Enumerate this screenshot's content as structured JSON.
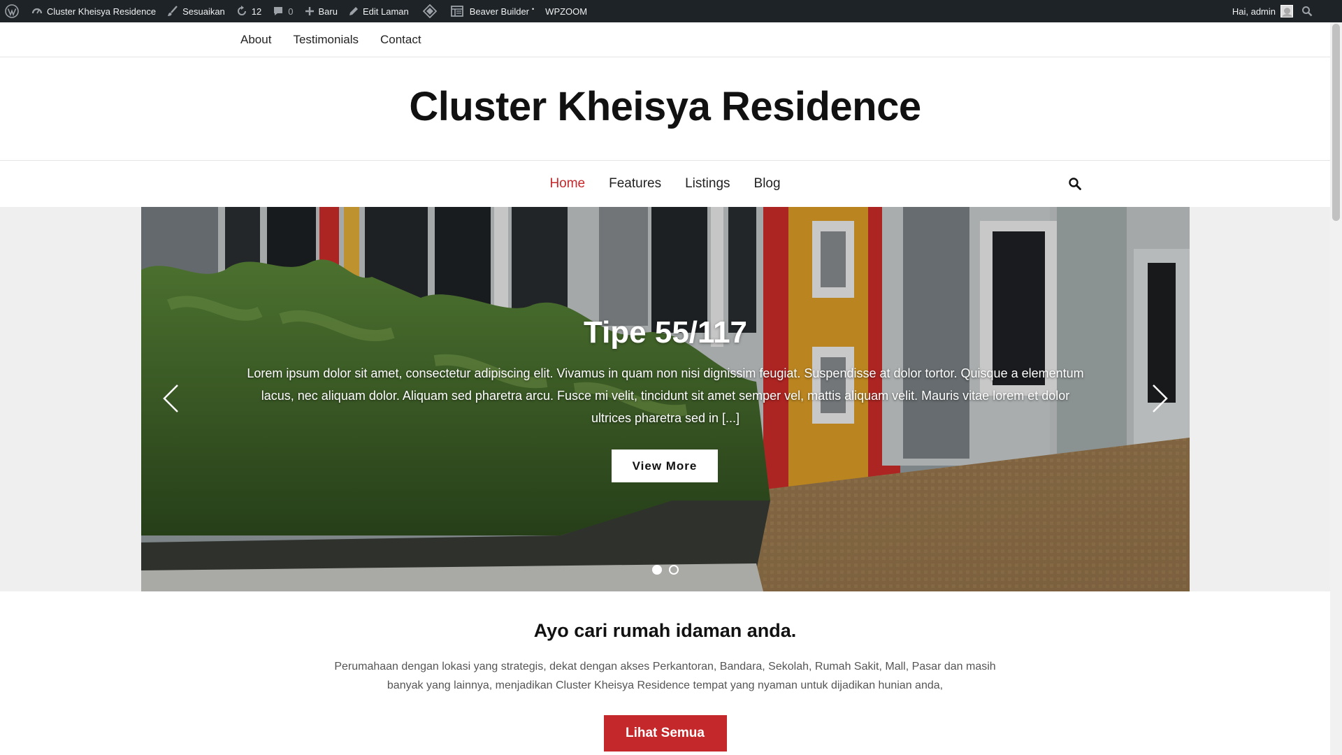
{
  "adminbar": {
    "site_name": "Cluster Kheisya Residence",
    "customize": "Sesuaikan",
    "updates_count": "12",
    "comments_count": "0",
    "new": "Baru",
    "edit_page": "Edit Laman",
    "beaver_builder": "Beaver Builder",
    "wpzoom": "WPZOOM",
    "greeting": "Hai, admin"
  },
  "top_nav": [
    "About",
    "Testimonials",
    "Contact"
  ],
  "header": {
    "site_title": "Cluster Kheisya Residence"
  },
  "main_nav": {
    "items": [
      {
        "label": "Home",
        "active": true
      },
      {
        "label": "Features",
        "active": false
      },
      {
        "label": "Listings",
        "active": false
      },
      {
        "label": "Blog",
        "active": false
      }
    ],
    "search_icon": "search-icon"
  },
  "slider": {
    "title": "Tipe 55/117",
    "text": "Lorem ipsum dolor sit amet, consectetur adipiscing elit. Vivamus in quam non nisi dignissim feugiat. Suspendisse at dolor tortor. Quisque a elementum lacus, nec aliquam dolor. Aliquam sed pharetra arcu. Fusce mi velit, tincidunt sit amet semper vel, mattis aliquam velit. Mauris vitae lorem et dolor ultrices pharetra sed in [...]",
    "button": "View More",
    "slide_count": 2,
    "active_slide": 1
  },
  "intro": {
    "heading": "Ayo cari rumah idaman anda.",
    "text": "Perumahaan dengan lokasi yang strategis, dekat dengan akses Perkantoran, Bandara, Sekolah, Rumah Sakit, Mall, Pasar dan masih banyak yang lainnya, menjadikan Cluster Kheisya Residence tempat yang nyaman untuk dijadikan hunian anda,",
    "button": "Lihat Semua"
  },
  "colors": {
    "accent": "#c5282b",
    "adminbar_bg": "#1d2327"
  }
}
